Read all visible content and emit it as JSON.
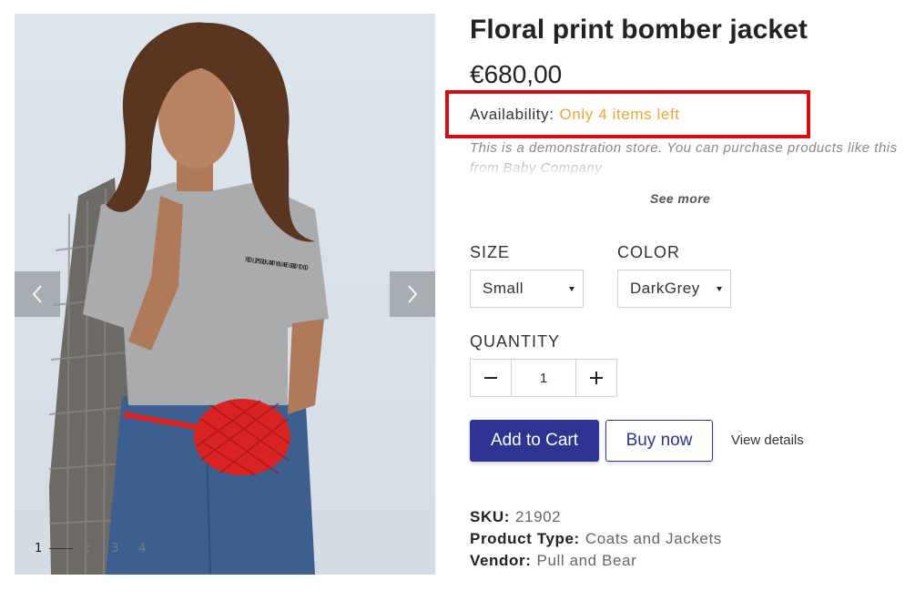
{
  "gallery": {
    "shirt_text": "RED LIPSTICK AND YOU ARE GOOD TO GO",
    "pages": [
      "1",
      "2",
      "3",
      "4"
    ],
    "active_page": "1",
    "prev_icon": "chevron-left-icon",
    "next_icon": "chevron-right-icon"
  },
  "product": {
    "title": "Floral print bomber jacket",
    "price": "€680,00",
    "availability_label": "Availability:",
    "availability_value": "Only 4 items left",
    "description": "This is a demonstration store. You can purchase products like this from Baby Company",
    "see_more": "See more"
  },
  "options": {
    "size_label": "SIZE",
    "size_value": "Small",
    "color_label": "COLOR",
    "color_value": "DarkGrey",
    "quantity_label": "QUANTITY",
    "quantity_value": "1",
    "minus_icon": "minus-icon",
    "plus_icon": "plus-icon"
  },
  "actions": {
    "add_to_cart": "Add to Cart",
    "buy_now": "Buy now",
    "view_details": "View details"
  },
  "meta": {
    "sku_label": "SKU:",
    "sku_value": "21902",
    "type_label": "Product Type:",
    "type_value": "Coats and Jackets",
    "vendor_label": "Vendor:",
    "vendor_value": "Pull and Bear"
  },
  "colors": {
    "primary": "#2e3494",
    "availability": "#eda83a",
    "highlight_box": "#d50f0f"
  }
}
